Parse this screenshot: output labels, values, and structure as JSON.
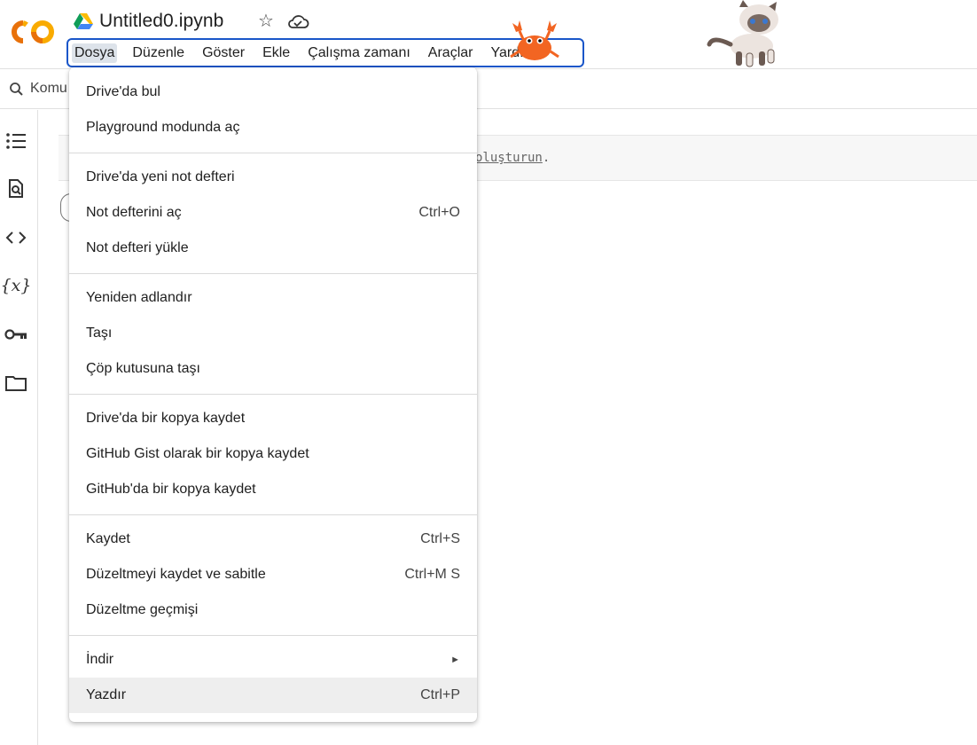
{
  "app": {
    "logo_text": "CO",
    "notebook_title": "Untitled0.ipynb"
  },
  "menubar": {
    "items": [
      "Dosya",
      "Düzenle",
      "Göster",
      "Ekle",
      "Çalışma zamanı",
      "Araçlar",
      "Yardım"
    ],
    "active": "Dosya"
  },
  "toolbar": {
    "commands_label": "Komu"
  },
  "cell": {
    "visible_link_text": "oluşturun",
    "visible_suffix": "."
  },
  "file_menu": {
    "items": [
      {
        "label": "Drive'da bul",
        "shortcut": ""
      },
      {
        "label": "Playground modunda aç",
        "shortcut": ""
      },
      {
        "label": "Drive'da yeni not defteri",
        "shortcut": ""
      },
      {
        "label": "Not defterini aç",
        "shortcut": "Ctrl+O"
      },
      {
        "label": "Not defteri yükle",
        "shortcut": ""
      },
      {
        "label": "Yeniden adlandır",
        "shortcut": ""
      },
      {
        "label": "Taşı",
        "shortcut": ""
      },
      {
        "label": "Çöp kutusuna taşı",
        "shortcut": ""
      },
      {
        "label": "Drive'da bir kopya kaydet",
        "shortcut": ""
      },
      {
        "label": "GitHub Gist olarak bir kopya kaydet",
        "shortcut": ""
      },
      {
        "label": "GitHub'da bir kopya kaydet",
        "shortcut": ""
      },
      {
        "label": "Kaydet",
        "shortcut": "Ctrl+S"
      },
      {
        "label": "Düzeltmeyi kaydet ve sabitle",
        "shortcut": "Ctrl+M S"
      },
      {
        "label": "Düzeltme geçmişi",
        "shortcut": ""
      },
      {
        "label": "İndir",
        "shortcut": "►"
      },
      {
        "label": "Yazdır",
        "shortcut": "Ctrl+P"
      }
    ],
    "hovered": "Yazdır"
  },
  "icons": {
    "rail": [
      "toc-icon",
      "find-replace-icon",
      "code-snippets-icon",
      "variables-icon",
      "secrets-key-icon",
      "files-folder-icon"
    ]
  },
  "colors": {
    "menubar_outline": "#1a56c9",
    "logo_orange": "#f9ab00",
    "logo_dark_orange": "#e8710a"
  }
}
